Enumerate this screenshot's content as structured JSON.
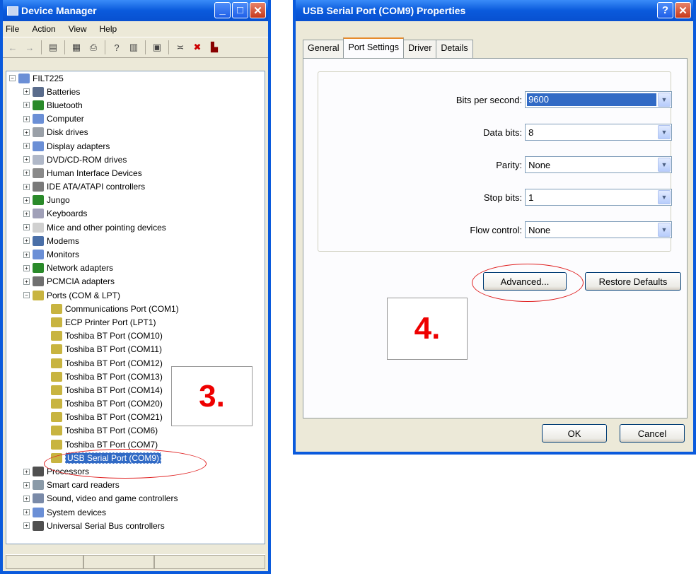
{
  "device_manager": {
    "title": "Device Manager",
    "menu": [
      "File",
      "Action",
      "View",
      "Help"
    ],
    "root": "FILT225",
    "categories_before": [
      {
        "label": "Batteries",
        "color": "#5a6c8c"
      },
      {
        "label": "Bluetooth",
        "color": "#2a8a2a"
      },
      {
        "label": "Computer",
        "color": "#6b8fd6"
      },
      {
        "label": "Disk drives",
        "color": "#9aa0a8"
      },
      {
        "label": "Display adapters",
        "color": "#6b8fd6"
      },
      {
        "label": "DVD/CD-ROM drives",
        "color": "#b0b8c8"
      },
      {
        "label": "Human Interface Devices",
        "color": "#8a8a8a"
      },
      {
        "label": "IDE ATA/ATAPI controllers",
        "color": "#7a7a7a"
      },
      {
        "label": "Jungo",
        "color": "#2a8a2a"
      },
      {
        "label": "Keyboards",
        "color": "#a0a0b8"
      },
      {
        "label": "Mice and other pointing devices",
        "color": "#d0d0d0"
      },
      {
        "label": "Modems",
        "color": "#4a6fa8"
      },
      {
        "label": "Monitors",
        "color": "#6b8fd6"
      },
      {
        "label": "Network adapters",
        "color": "#2a8a2a"
      },
      {
        "label": "PCMCIA adapters",
        "color": "#707070"
      }
    ],
    "ports_label": "Ports (COM & LPT)",
    "ports": [
      "Communications Port (COM1)",
      "ECP Printer Port (LPT1)",
      "Toshiba BT Port (COM10)",
      "Toshiba BT Port (COM11)",
      "Toshiba BT Port (COM12)",
      "Toshiba BT Port (COM13)",
      "Toshiba BT Port (COM14)",
      "Toshiba BT Port (COM20)",
      "Toshiba BT Port (COM21)",
      "Toshiba BT Port (COM6)",
      "Toshiba BT Port (COM7)"
    ],
    "selected_port": "USB Serial Port (COM9)",
    "categories_after": [
      {
        "label": "Processors",
        "color": "#505050"
      },
      {
        "label": "Smart card readers",
        "color": "#8a9aa8"
      },
      {
        "label": "Sound, video and game controllers",
        "color": "#7a8aa8"
      },
      {
        "label": "System devices",
        "color": "#6b8fd6"
      },
      {
        "label": "Universal Serial Bus controllers",
        "color": "#505050"
      }
    ]
  },
  "properties": {
    "title": "USB Serial Port (COM9) Properties",
    "tabs": [
      "General",
      "Port Settings",
      "Driver",
      "Details"
    ],
    "fields": [
      {
        "label": "Bits per second:",
        "value": "9600"
      },
      {
        "label": "Data bits:",
        "value": "8"
      },
      {
        "label": "Parity:",
        "value": "None"
      },
      {
        "label": "Stop bits:",
        "value": "1"
      },
      {
        "label": "Flow control:",
        "value": "None"
      }
    ],
    "advanced_label": "Advanced...",
    "restore_label": "Restore Defaults",
    "ok_label": "OK",
    "cancel_label": "Cancel"
  },
  "annotations": {
    "step3": "3.",
    "step4": "4."
  },
  "accent_color": "#e02020"
}
